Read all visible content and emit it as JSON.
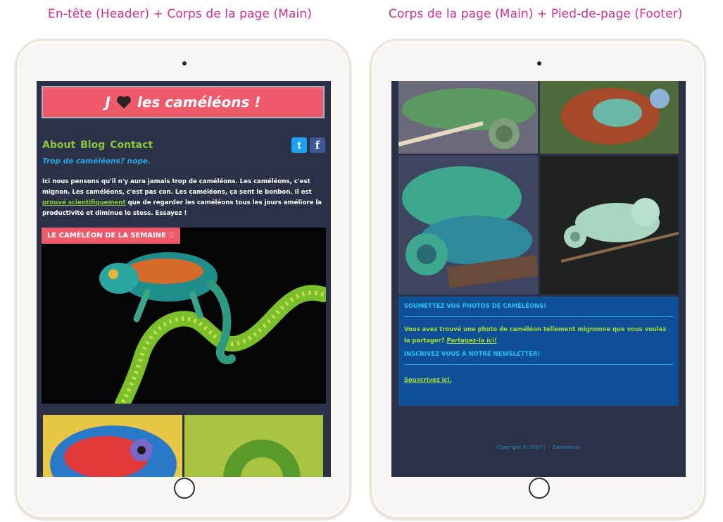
{
  "captions": {
    "left": "En-tête (Header) + Corps de la page (Main)",
    "right": "Corps de la page (Main) + Pied-de-page (Footer)"
  },
  "header": {
    "title_pre": "J",
    "title_post": "les caméléons !",
    "nav": [
      "About",
      "Blog",
      "Contact"
    ],
    "social_icons": [
      "twitter-icon",
      "facebook-icon"
    ],
    "twitter_glyph": "t",
    "facebook_glyph": "f"
  },
  "main": {
    "tagline": "Trop de caméléons? nope.",
    "intro_before_link": "Ici nous pensons qu'il n'y aura jamais trop de caméléons. Les caméléons, c'est mignon. Les caméléons, c'est pas con. Les caméléons, ça sent le bonbon. Il est",
    "intro_link": "prouvé scientifiquement",
    "intro_after_link": "que de regarder les caméléons tous les jours améliore la productivité et diminue le stess. Essayez !",
    "feature_badge": "LE CAMÉLÉON DE LA SEMAINE ♡"
  },
  "footer": {
    "submit_title": "SOUMETTEZ VOS PHOTOS DE CAMÉLÉONS!",
    "submit_text": "Vous avez trouvé une photo de caméléon tellement mignonne que vous voulez la partager?",
    "submit_link": "Partagez-la ici!",
    "newsletter_title": "INSCRIVEZ VOUS À NOTRE NEWSLETTER!",
    "subscribe_link": "Souscrivez ici.",
    "copyright_before": "Copyright © 2017 |",
    "copyright_after": "Caméléons"
  },
  "colors": {
    "accent_pink": "#ee5a6b",
    "nav_green": "#8dc63f",
    "tagline_blue": "#29a8e0",
    "page_bg": "#2b3247",
    "footer_box": "#0e4f97",
    "caption_magenta": "#cc2f96"
  }
}
